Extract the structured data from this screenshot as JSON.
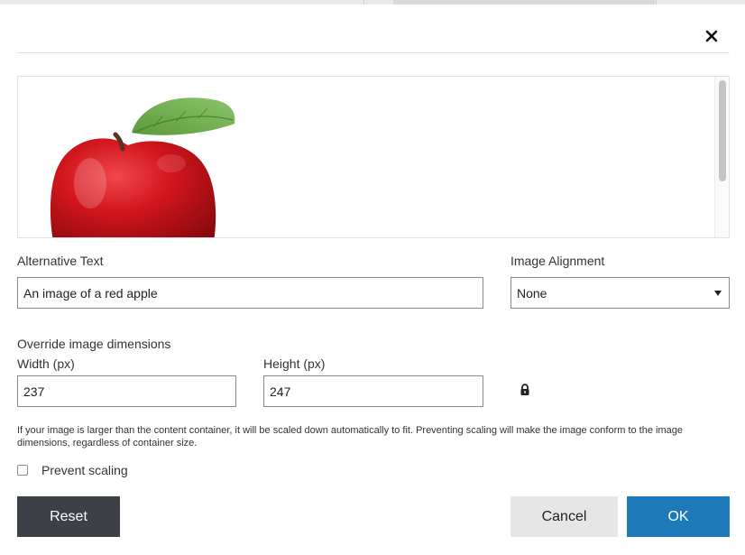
{
  "dialog": {
    "close_icon": "close-icon",
    "preview": {
      "image_icon": "apple-image"
    },
    "alt_text": {
      "label": "Alternative Text",
      "value": "An image of a red apple"
    },
    "alignment": {
      "label": "Image Alignment",
      "selected": "None",
      "icon": "chevron-down-icon"
    },
    "dimensions": {
      "heading": "Override image dimensions",
      "width_label": "Width (px)",
      "width_value": "237",
      "height_label": "Height (px)",
      "height_value": "247",
      "lock_icon": "lock-icon"
    },
    "help_text": "If your image is larger than the content container, it will be scaled down automatically to fit. Preventing scaling will make the image conform to the image dimensions, regardless of container size.",
    "prevent_scaling": {
      "label": "Prevent scaling",
      "checked": false
    },
    "buttons": {
      "reset": "Reset",
      "cancel": "Cancel",
      "ok": "OK"
    }
  },
  "colors": {
    "reset_bg": "#3d4147",
    "cancel_bg": "#e6e6e6",
    "ok_bg": "#1e79b8",
    "input_border": "#8a8a8a"
  }
}
